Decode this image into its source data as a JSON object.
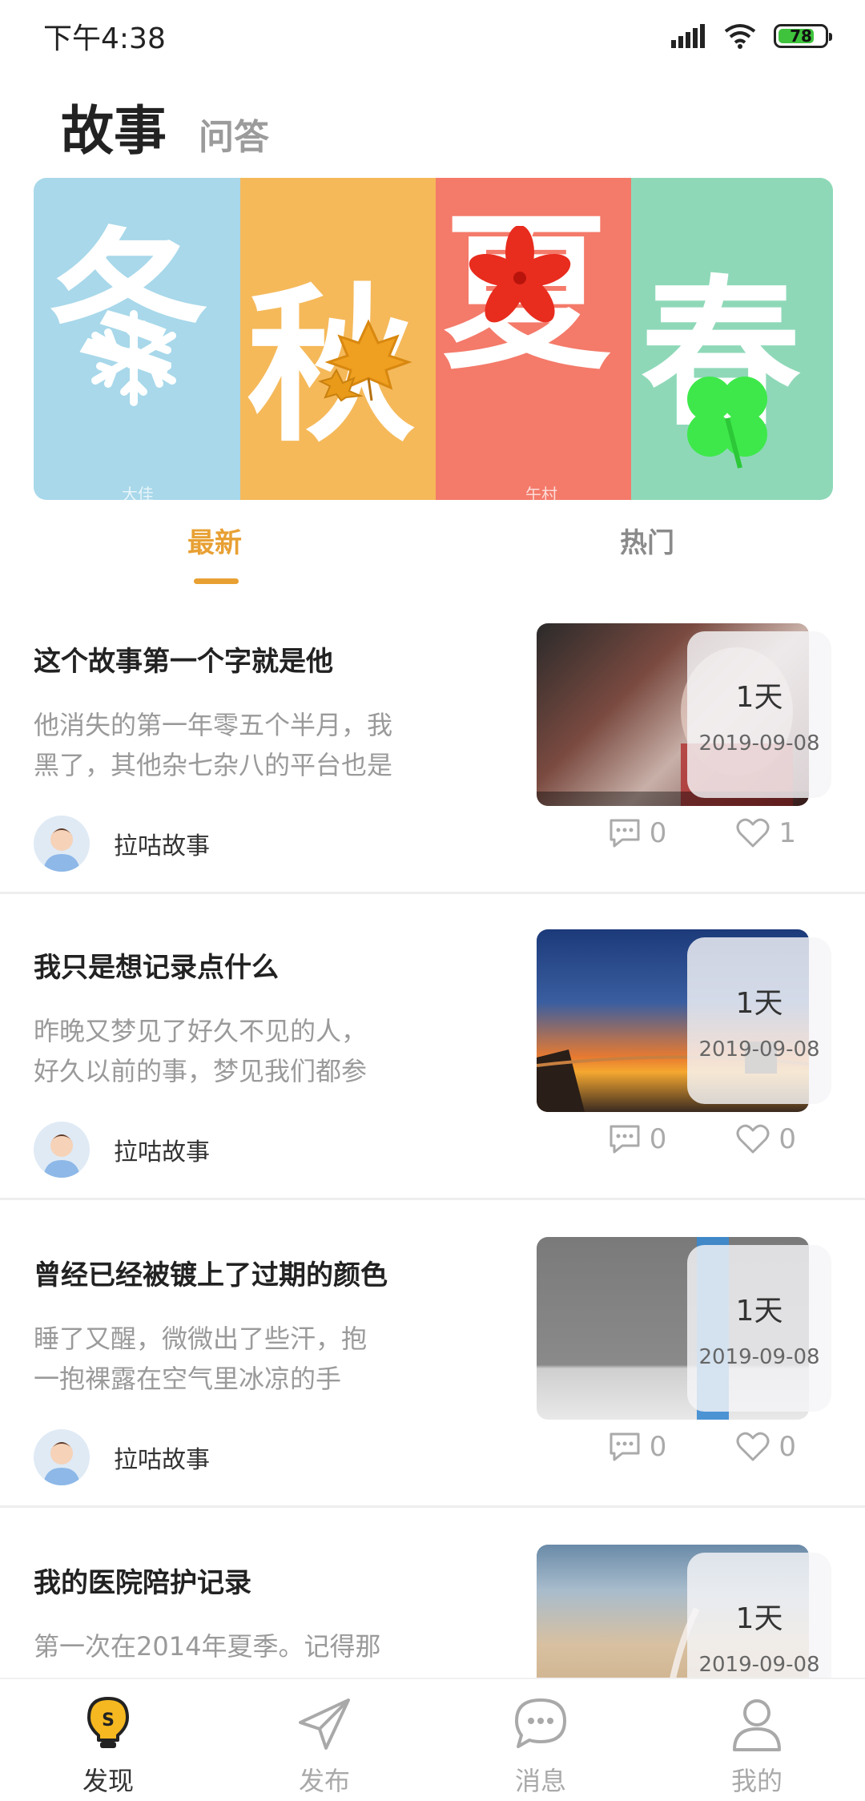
{
  "status_bar": {
    "time": "下午4:38",
    "battery": "78",
    "battery_level": 0.78
  },
  "header": {
    "active_tab": "故事",
    "other_tab": "问答"
  },
  "banner": {
    "seasons": [
      {
        "char": "冬",
        "caption": "大佳"
      },
      {
        "char": "秋",
        "caption": ""
      },
      {
        "char": "夏",
        "caption": "午村"
      },
      {
        "char": "春",
        "caption": ""
      }
    ]
  },
  "feed_tabs": {
    "latest": "最新",
    "hot": "热门"
  },
  "stories": [
    {
      "title": "这个故事第一个字就是他",
      "excerpt_line1": "他消失的第一年零五个半月，我",
      "excerpt_line2": "黑了，其他杂七杂八的平台也是",
      "author": "拉咕故事",
      "comments": "0",
      "likes": "1",
      "days": "1天",
      "date": "2019-09-08"
    },
    {
      "title": "我只是想记录点什么",
      "excerpt_line1": "昨晚又梦见了好久不见的人，",
      "excerpt_line2": "好久以前的事，梦见我们都参",
      "author": "拉咕故事",
      "comments": "0",
      "likes": "0",
      "days": "1天",
      "date": "2019-09-08"
    },
    {
      "title": "曾经已经被镀上了过期的颜色",
      "excerpt_line1": "睡了又醒，微微出了些汗，抱",
      "excerpt_line2": "一抱裸露在空气里冰凉的手",
      "author": "拉咕故事",
      "comments": "0",
      "likes": "0",
      "days": "1天",
      "date": "2019-09-08"
    },
    {
      "title": "我的医院陪护记录",
      "excerpt_line1": "第一次在2014年夏季。记得那",
      "excerpt_line2": "",
      "author": "",
      "comments": "",
      "likes": "",
      "days": "1天",
      "date": "2019-09-08"
    }
  ],
  "bottom_nav": [
    {
      "label": "发现",
      "icon": "bulb-icon"
    },
    {
      "label": "发布",
      "icon": "paper-plane-icon"
    },
    {
      "label": "消息",
      "icon": "chat-bubble-icon"
    },
    {
      "label": "我的",
      "icon": "person-icon"
    }
  ],
  "colors": {
    "accent": "#e8a033",
    "winter": "#a8d8ea",
    "autumn": "#f5b95a",
    "summer": "#f47a6a",
    "spring": "#8ed8b8"
  }
}
